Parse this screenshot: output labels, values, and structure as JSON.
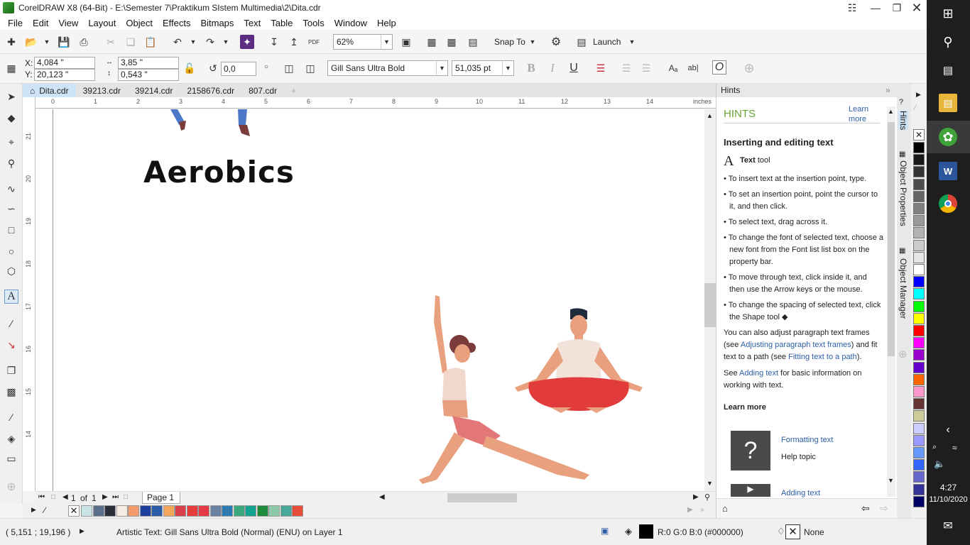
{
  "window": {
    "title": "CorelDRAW X8 (64-Bit) - E:\\Semester 7\\Praktikum SIstem Multimedia\\2\\Dita.cdr"
  },
  "menu": [
    "File",
    "Edit",
    "View",
    "Layout",
    "Object",
    "Effects",
    "Bitmaps",
    "Text",
    "Table",
    "Tools",
    "Window",
    "Help"
  ],
  "toolbar": {
    "zoom": "62%",
    "snap_to": "Snap To",
    "launch": "Launch"
  },
  "propbar": {
    "x_label": "X:",
    "x_value": "4,084 \"",
    "y_label": "Y:",
    "y_value": "20,123 \"",
    "w_value": "3,85 \"",
    "h_value": "0,543 \"",
    "rotation": "0,0",
    "font": "Gill Sans Ultra Bold",
    "font_size": "51,035 pt"
  },
  "doc_tabs": [
    "Dita.cdr",
    "39213.cdr",
    "39214.cdr",
    "2158676.cdr",
    "807.cdr"
  ],
  "ruler": {
    "h_numbers": [
      "0",
      "1",
      "2",
      "3",
      "4",
      "5",
      "6",
      "7",
      "8",
      "9",
      "10",
      "11",
      "12",
      "13",
      "14"
    ],
    "unit": "inches",
    "v_numbers": [
      "21",
      "20",
      "19",
      "18",
      "17",
      "16",
      "15",
      "14"
    ]
  },
  "canvas": {
    "heading": "Aerobics"
  },
  "page_nav": {
    "current": "1",
    "of": "of",
    "total": "1",
    "page_tab": "Page 1"
  },
  "docker": {
    "header": "Hints",
    "section_title": "HINTS",
    "learn_more_link": "Learn more",
    "topic_title": "Inserting and editing text",
    "tool_name": "Text",
    "tool_suffix": "tool",
    "bullets": [
      "To insert text at the insertion point, type.",
      "To set an insertion point, point the cursor to it, and then click.",
      "To select text, drag across it.",
      "To change the font of selected text, choose a new font from the Font list list box on the property bar.",
      "To move through text, click inside it, and then use the Arrow keys or the mouse.",
      "To change the spacing of selected text, click the Shape tool"
    ],
    "para1_a": "You can also adjust paragraph text frames (see ",
    "para1_link1": "Adjusting paragraph text frames",
    "para1_b": ") and fit text to a path (see ",
    "para1_link2": "Fitting text to a path",
    "para1_c": ").",
    "para2_a": "See ",
    "para2_link": "Adding text",
    "para2_b": " for basic information on working with text.",
    "learn_more_heading": "Learn more",
    "cards": [
      {
        "title": "Formatting text",
        "subtitle": "Help topic"
      },
      {
        "title": "Adding text"
      }
    ]
  },
  "vertical_tabs": [
    "Hints",
    "Object Properties",
    "Object Manager"
  ],
  "status": {
    "coords": "( 5,151 ; 19,196 )",
    "info": "Artistic Text: Gill Sans Ultra Bold (Normal) (ENU) on Layer 1",
    "fill_info": "R:0 G:0 B:0 (#000000)",
    "outline": "None"
  },
  "taskbar": {
    "time": "4:27",
    "date": "11/10/2020"
  },
  "colors": {
    "bottom_palette": [
      "#c9e2e8",
      "#5a6e8c",
      "#2b2f3c",
      "#f6ece1",
      "#f29a6b",
      "#1c3f9e",
      "#2a5ca8",
      "#f2a65a",
      "#d9404a",
      "#e63b3b",
      "#e63946",
      "#6b7fa3",
      "#2d7ab3",
      "#3aa97b",
      "#10a38e",
      "#1c8c3a",
      "#8cc9a8",
      "#47a89a",
      "#e64e3a"
    ],
    "right_palette": [
      "#000000",
      "#1a1a1a",
      "#333333",
      "#4d4d4d",
      "#666666",
      "#808080",
      "#999999",
      "#b3b3b3",
      "#cccccc",
      "#e6e6e6",
      "#ffffff",
      "#0000ff",
      "#00ffff",
      "#00ff00",
      "#ffff00",
      "#ff0000",
      "#ff00ff",
      "#9900cc",
      "#6600cc",
      "#ff6600",
      "#ff99cc",
      "#663333",
      "#cccc99",
      "#ccccff",
      "#9999ff",
      "#6699ff",
      "#3366ff",
      "#6666cc",
      "#333399",
      "#000066"
    ]
  }
}
